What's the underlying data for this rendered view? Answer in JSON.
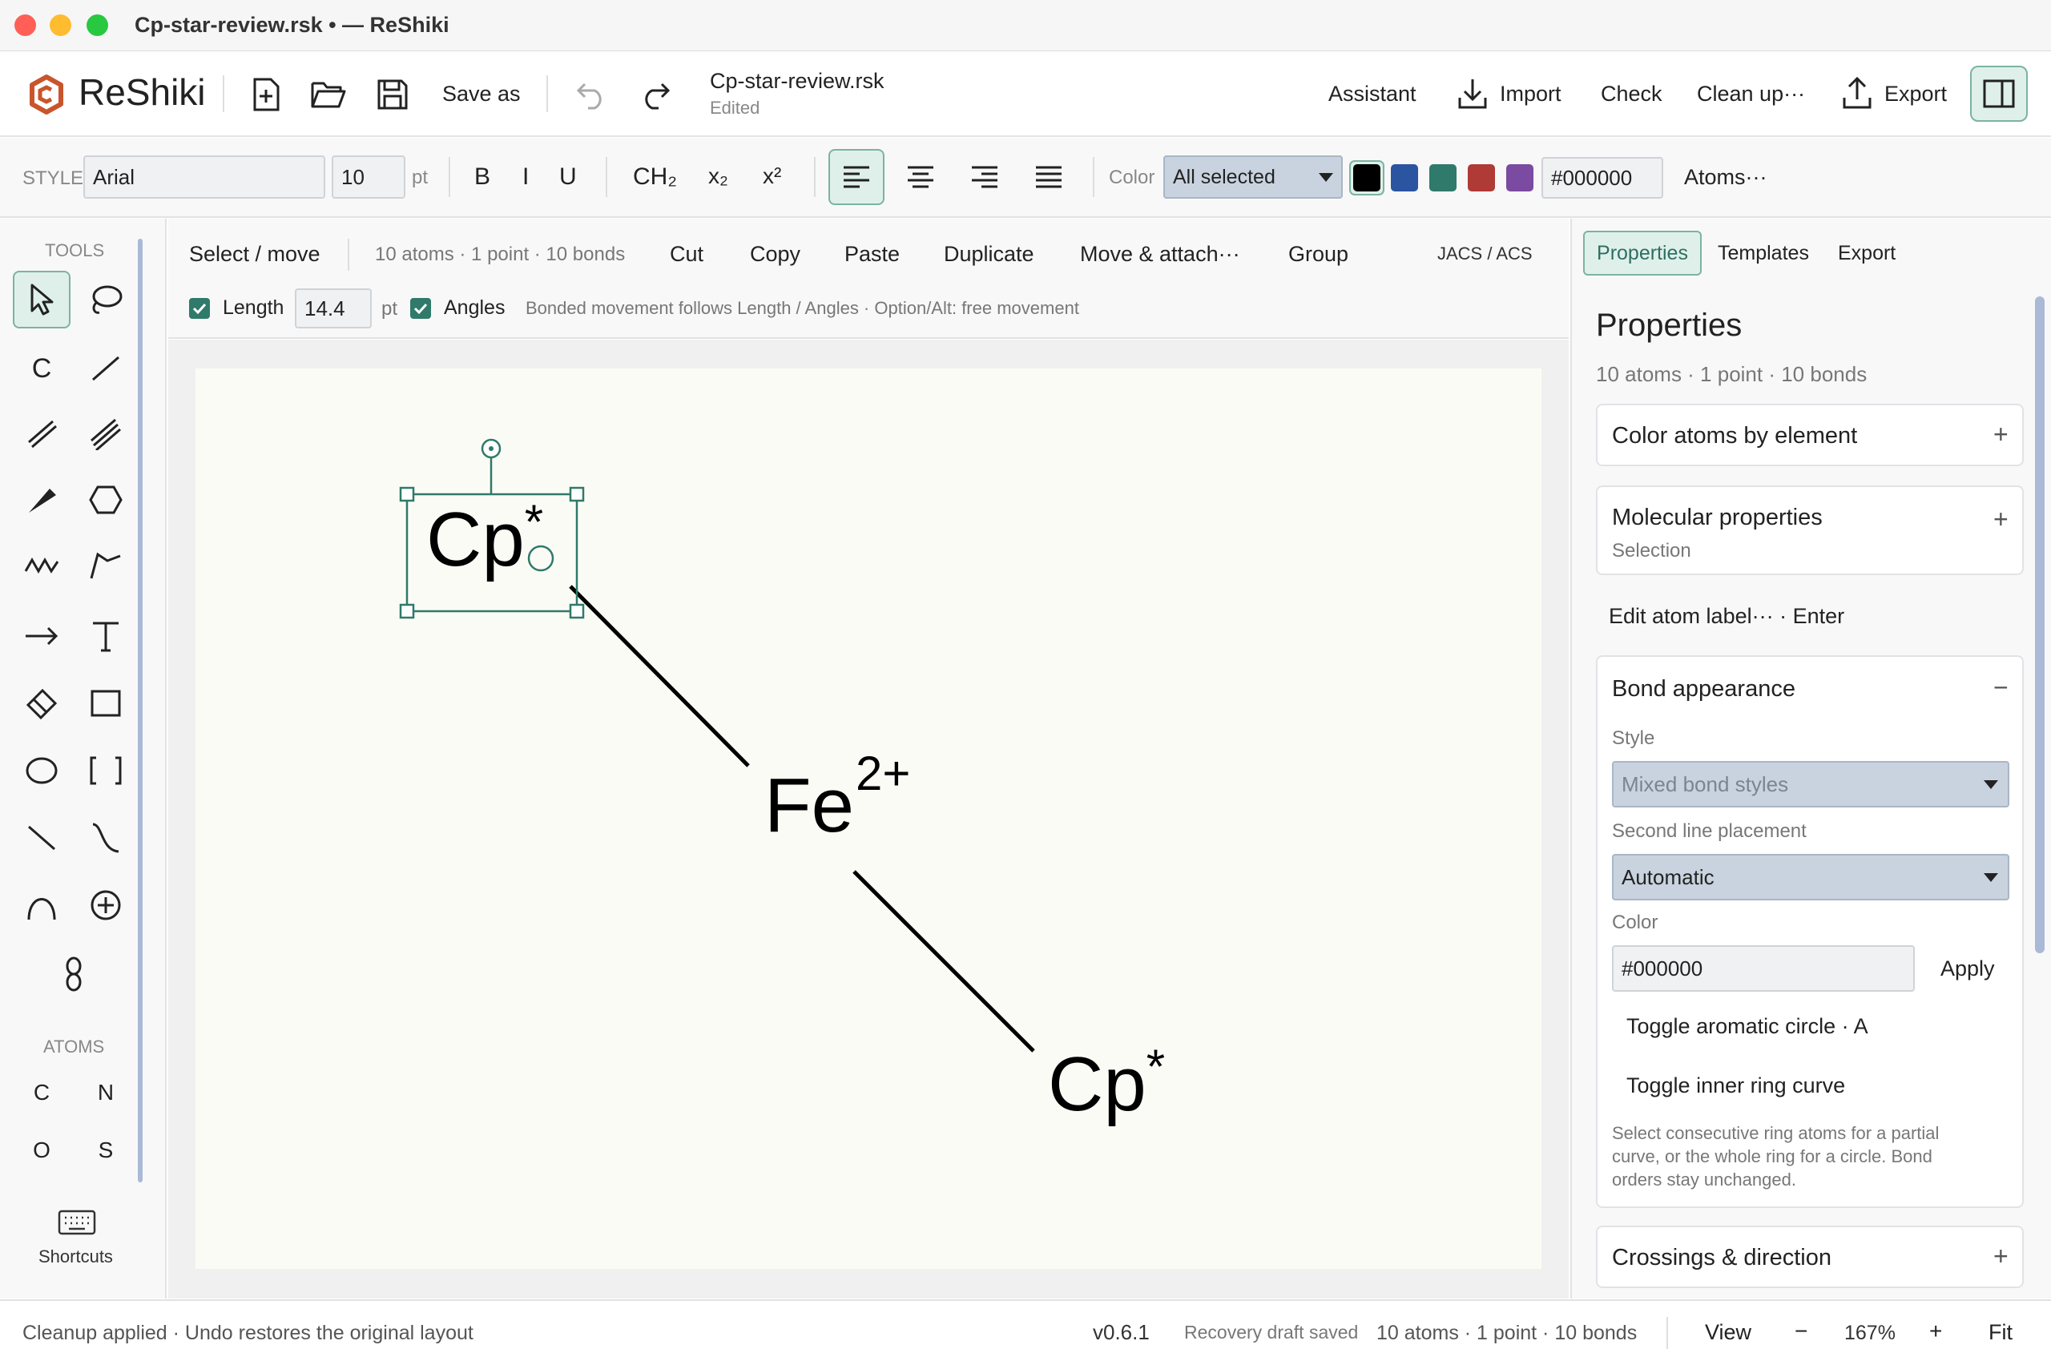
{
  "window": {
    "title": "Cp-star-review.rsk • — ReShiki",
    "colors": {
      "close": "#ff5f57",
      "minimize": "#febc2e",
      "zoom": "#28c840"
    }
  },
  "app": {
    "name": "ReShiki",
    "save_as": "Save as",
    "file_name": "Cp-star-review.rsk",
    "file_status": "Edited",
    "actions": {
      "assistant": "Assistant",
      "import": "Import",
      "check": "Check",
      "cleanup": "Clean up···",
      "export": "Export"
    },
    "accent": "#2f7a6a",
    "logo_color": "#c8552c"
  },
  "style_bar": {
    "label": "STYLE",
    "font_family": "Arial",
    "font_size": "10",
    "font_unit": "pt",
    "bold": "B",
    "italic": "I",
    "underline": "U",
    "ch2": "CH₂",
    "subscript": "x₂",
    "superscript": "x²",
    "color_label": "Color",
    "color_scope": "All selected",
    "swatches": [
      "#000000",
      "#2b55a1",
      "#2f7a6a",
      "#b03a36",
      "#7a4ba0"
    ],
    "hex_value": "#000000",
    "atoms_menu": "Atoms···"
  },
  "tools": {
    "header": "TOOLS",
    "atoms_header": "ATOMS",
    "atom_buttons": [
      "C",
      "N",
      "O",
      "S"
    ],
    "carbon_tool": "C",
    "shortcuts": "Shortcuts"
  },
  "workbar": {
    "mode": "Select / move",
    "selection_info": "10 atoms · 1 point · 10 bonds",
    "cut": "Cut",
    "copy": "Copy",
    "paste": "Paste",
    "duplicate": "Duplicate",
    "move_attach": "Move & attach···",
    "group": "Group",
    "style_preset": "JACS / ACS",
    "length_label": "Length",
    "length_value": "14.4",
    "length_unit": "pt",
    "angles_label": "Angles",
    "hint": "Bonded movement follows Length / Angles · Option/Alt: free movement"
  },
  "canvas": {
    "cp_top": "Cp",
    "star": "*",
    "fe": "Fe",
    "fe_charge": "2+",
    "cp_bottom": "Cp"
  },
  "right_panel": {
    "tabs": [
      "Properties",
      "Templates",
      "Export"
    ],
    "title": "Properties",
    "selection_info": "10 atoms · 1 point · 10 bonds",
    "color_atoms": "Color atoms by element",
    "molecular_properties": "Molecular properties",
    "molecular_sub": "Selection",
    "edit_label": "Edit atom label··· · Enter",
    "bond_appearance": "Bond appearance",
    "style_label": "Style",
    "style_value": "Mixed bond styles",
    "second_line_label": "Second line placement",
    "second_line_value": "Automatic",
    "color_label": "Color",
    "color_value": "#000000",
    "apply": "Apply",
    "toggle_aromatic": "Toggle aromatic circle · A",
    "toggle_inner": "Toggle inner ring curve",
    "help_line1": "Select consecutive ring atoms for a partial",
    "help_line2": "curve, or the whole ring for a circle. Bond",
    "help_line3": "orders stay unchanged.",
    "crossings": "Crossings & direction",
    "plus": "+",
    "minus": "−"
  },
  "status": {
    "message": "Cleanup applied · Undo restores the original layout",
    "version": "v0.6.1",
    "recovery": "Recovery draft saved",
    "selection_info": "10 atoms · 1 point · 10 bonds",
    "view": "View",
    "zoom_out": "−",
    "zoom": "167%",
    "zoom_in": "+",
    "fit": "Fit"
  }
}
